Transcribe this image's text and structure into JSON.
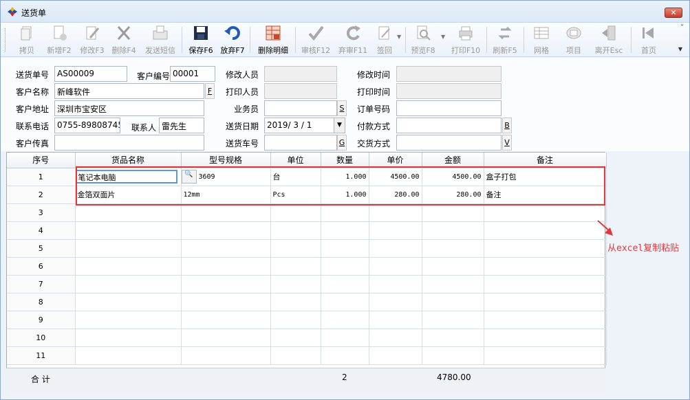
{
  "window": {
    "title": "送货单",
    "close": "✕"
  },
  "toolbar": {
    "buttons": [
      {
        "label": "拷贝",
        "icon": "copy-icon",
        "enabled": false
      },
      {
        "label": "新增F2",
        "icon": "new-doc-icon",
        "enabled": false
      },
      {
        "label": "修改F3",
        "icon": "edit-icon",
        "enabled": false
      },
      {
        "label": "删除F4",
        "icon": "delete-x-icon",
        "enabled": false
      },
      {
        "label": "发送短信",
        "icon": "sms-icon",
        "enabled": false
      },
      {
        "label": "保存F6",
        "icon": "save-icon",
        "enabled": true
      },
      {
        "label": "放弃F7",
        "icon": "undo-icon",
        "enabled": true
      },
      {
        "label": "删除明细",
        "icon": "delete-detail-icon",
        "enabled": true
      },
      {
        "label": "审核F12",
        "icon": "check-icon",
        "enabled": false
      },
      {
        "label": "弃审F11",
        "icon": "unapprove-icon",
        "enabled": false
      },
      {
        "label": "签回",
        "icon": "signback-icon",
        "enabled": false
      },
      {
        "label": "预览F8",
        "icon": "preview-icon",
        "enabled": false
      },
      {
        "label": "打印F10",
        "icon": "print-icon",
        "enabled": false
      },
      {
        "label": "刷新F5",
        "icon": "refresh-icon",
        "enabled": false
      },
      {
        "label": "网格",
        "icon": "grid-icon",
        "enabled": false
      },
      {
        "label": "项目",
        "icon": "items-icon",
        "enabled": false
      },
      {
        "label": "离开Esc",
        "icon": "exit-icon",
        "enabled": false
      },
      {
        "label": "首页",
        "icon": "first-page-icon",
        "enabled": false
      }
    ]
  },
  "form": {
    "order_no_label": "送货单号",
    "order_no": "AS00009",
    "customer_code_label": "客户编号",
    "customer_code": "00001",
    "modifier_label": "修改人员",
    "modifier": "",
    "modify_time_label": "修改时间",
    "modify_time": "",
    "customer_name_label": "客户名称",
    "customer_name": "新峰软件",
    "customer_name_btn": "F",
    "printer_label": "打印人员",
    "printer": "",
    "print_time_label": "打印时间",
    "print_time": "",
    "address_label": "客户地址",
    "address": "深圳市宝安区",
    "salesman_label": "业务员",
    "salesman": "",
    "salesman_btn": "S",
    "po_no_label": "订单号码",
    "po_no": "",
    "phone_label": "联系电话",
    "phone": "0755-89808745",
    "contact_label": "联系人",
    "contact": "雷先生",
    "date_label": "送货日期",
    "date": "2019/ 3 / 1",
    "payment_label": "付款方式",
    "payment": "",
    "payment_btn": "B",
    "fax_label": "客户传真",
    "fax": "",
    "truck_label": "送货车号",
    "truck": "",
    "truck_btn": "G",
    "delivery_label": "交货方式",
    "delivery": "",
    "delivery_btn": "V"
  },
  "grid": {
    "columns": [
      "序号",
      "货品名称",
      "型号规格",
      "单位",
      "数量",
      "单价",
      "金额",
      "备注"
    ],
    "rows": [
      {
        "idx": "1",
        "name": "笔记本电脑",
        "model": "3609",
        "unit": "台",
        "qty": "1.000",
        "price": "4500.00",
        "amount": "4500.00",
        "note": "盒子打包"
      },
      {
        "idx": "2",
        "name": "金箔双面片",
        "model": "12mm",
        "unit": "Pcs",
        "qty": "1.000",
        "price": "280.00",
        "amount": "280.00",
        "note": "备注"
      },
      {
        "idx": "3"
      },
      {
        "idx": "4"
      },
      {
        "idx": "5"
      },
      {
        "idx": "6"
      },
      {
        "idx": "7"
      },
      {
        "idx": "8"
      },
      {
        "idx": "9"
      },
      {
        "idx": "10"
      },
      {
        "idx": "11"
      }
    ],
    "total_label": "合 计",
    "total_qty": "2",
    "total_amount": "4780.00"
  },
  "annotation": {
    "text": "从excel复制粘贴",
    "color": "#e0383a"
  }
}
